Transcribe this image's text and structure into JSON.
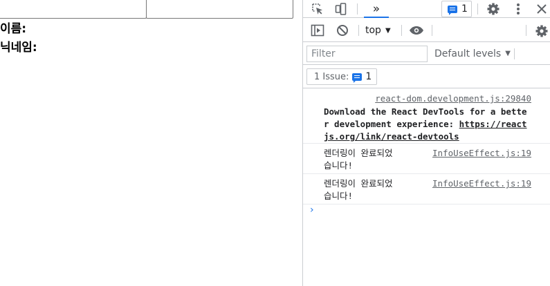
{
  "page": {
    "labels": [
      "이름:",
      "닉네임:"
    ]
  },
  "devtools": {
    "toolbar": {
      "more_tabs_label": "»",
      "issues_badge_count": "1"
    },
    "console_toolbar": {
      "context": "top"
    },
    "filter": {
      "placeholder": "Filter",
      "levels_label": "Default levels"
    },
    "issues": {
      "label": "1 Issue:",
      "count": "1"
    },
    "messages": [
      {
        "source": "react-dom.development.js:29840",
        "text": "Download the React DevTools for a better development experience: ",
        "link": "https://reactjs.org/link/react-devtools"
      },
      {
        "source": "InfoUseEffect.js:19",
        "line1": "렌더링이 완료되었",
        "line2": "습니다!"
      },
      {
        "source": "InfoUseEffect.js:19",
        "line1": "렌더링이 완료되었",
        "line2": "습니다!"
      }
    ],
    "prompt": "›"
  },
  "colors": {
    "accent": "#1a73e8",
    "icon": "#5f6368",
    "border": "#cacdd1"
  }
}
